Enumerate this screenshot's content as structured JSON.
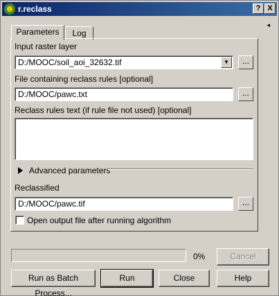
{
  "window": {
    "title": "r.reclass",
    "help_label": "?",
    "close_label": "X"
  },
  "tabs": [
    {
      "label": "Parameters",
      "active": true
    },
    {
      "label": "Log",
      "active": false
    }
  ],
  "collapse_label": "◂",
  "params": {
    "input_raster_label": "Input raster layer",
    "input_raster_value": "D:/MOOC/soil_aoi_32632.tif",
    "rules_file_label": "File containing reclass rules [optional]",
    "rules_file_value": "D:/MOOC/pawc.txt",
    "rules_text_label": "Reclass rules text (if rule file not used) [optional]",
    "rules_text_value": "",
    "advanced_label": "Advanced parameters",
    "output_label": "Reclassified",
    "output_value": "D:/MOOC/pawc.tif",
    "open_output_label": "Open output file after running algorithm",
    "open_output_checked": false,
    "browse_label": "..."
  },
  "progress": {
    "value": 0,
    "label": "0%"
  },
  "buttons": {
    "cancel": "Cancel",
    "batch": "Run as Batch Process...",
    "run": "Run",
    "close": "Close",
    "help": "Help"
  }
}
